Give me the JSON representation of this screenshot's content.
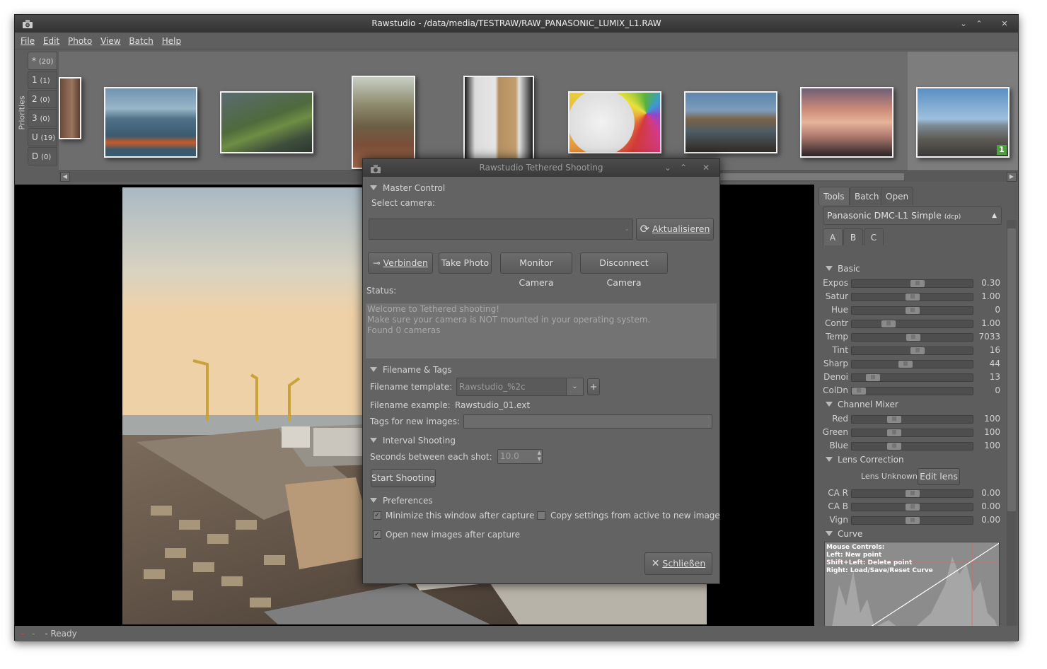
{
  "window": {
    "title": "Rawstudio - /data/media/TESTRAW/RAW_PANASONIC_LUMIX_L1.RAW",
    "controls": [
      "⌄",
      "⌃",
      "✕"
    ]
  },
  "menu": [
    "File",
    "Edit",
    "Photo",
    "View",
    "Batch",
    "Help"
  ],
  "priorities": {
    "label": "Priorities",
    "items": [
      {
        "name": "*",
        "count": "(20)"
      },
      {
        "name": "1",
        "count": "(1)"
      },
      {
        "name": "2",
        "count": "(0)"
      },
      {
        "name": "3",
        "count": "(0)"
      },
      {
        "name": "U",
        "count": "(19)"
      },
      {
        "name": "D",
        "count": "(0)"
      }
    ]
  },
  "thumb_badge": "1",
  "status_bar": "- Ready",
  "right_panel": {
    "tabs": [
      "Tools",
      "Batch",
      "Open"
    ],
    "profile": {
      "name": "Panasonic DMC-L1 Simple",
      "suffix": "(dcp)"
    },
    "subtabs": [
      "A",
      "B",
      "C"
    ],
    "basic": {
      "title": "Basic",
      "rows": [
        {
          "label": "Expos",
          "value": "0.30",
          "pos": 0.55
        },
        {
          "label": "Satur",
          "value": "1.00",
          "pos": 0.5
        },
        {
          "label": "Hue",
          "value": "0",
          "pos": 0.5
        },
        {
          "label": "Contr",
          "value": "1.00",
          "pos": 0.28
        },
        {
          "label": "Temp",
          "value": "7033",
          "pos": 0.51
        },
        {
          "label": "Tint",
          "value": "16",
          "pos": 0.55
        },
        {
          "label": "Sharp",
          "value": "44",
          "pos": 0.44
        },
        {
          "label": "Denoi",
          "value": "13",
          "pos": 0.13
        },
        {
          "label": "ColDn",
          "value": "0",
          "pos": 0.0
        }
      ]
    },
    "channel_mixer": {
      "title": "Channel Mixer",
      "rows": [
        {
          "label": "Red",
          "value": "100",
          "pos": 0.33
        },
        {
          "label": "Green",
          "value": "100",
          "pos": 0.33
        },
        {
          "label": "Blue",
          "value": "100",
          "pos": 0.33
        }
      ]
    },
    "lens_correction": {
      "title": "Lens Correction",
      "lens_name": "Lens Unknown",
      "edit_button": "Edit lens",
      "rows": [
        {
          "label": "CA R",
          "value": "0.00",
          "pos": 0.5
        },
        {
          "label": "CA B",
          "value": "0.00",
          "pos": 0.5
        },
        {
          "label": "Vign",
          "value": "0.00",
          "pos": 0.5
        }
      ]
    },
    "curve": {
      "title": "Curve",
      "help": [
        "Mouse Controls:",
        "Left: New point",
        "Shift+Left: Delete point",
        "Right: Load/Save/Reset Curve"
      ]
    }
  },
  "dialog": {
    "title": "Rawstudio Tethered Shooting",
    "master_control": "Master Control",
    "select_camera": "Select camera:",
    "refresh_button": "Aktualisieren",
    "buttons": {
      "connect": "Verbinden",
      "take_photo": "Take Photo",
      "monitor": "Monitor Camera",
      "disconnect": "Disconnect Camera"
    },
    "status_label": "Status:",
    "status_lines": [
      "Welcome to Tethered shooting!",
      "Make sure your camera is NOT mounted in your operating system.",
      "Found 0 cameras"
    ],
    "filename_section": "Filename & Tags",
    "filename_template_label": "Filename template:",
    "filename_template_value": "Rawstudio_%2c",
    "add_button": "+",
    "filename_example_label": "Filename example:",
    "filename_example_value": "Rawstudio_01.ext",
    "tags_label": "Tags for new images:",
    "tags_value": "",
    "interval_section": "Interval Shooting",
    "seconds_label": "Seconds between each shot:",
    "seconds_value": "10.0",
    "start_button": "Start Shooting",
    "preferences_section": "Preferences",
    "pref_minimize": "Minimize this window after capture",
    "pref_copy": "Copy settings from active to new image",
    "pref_open": "Open new images after capture",
    "close_button": "Schließen"
  }
}
